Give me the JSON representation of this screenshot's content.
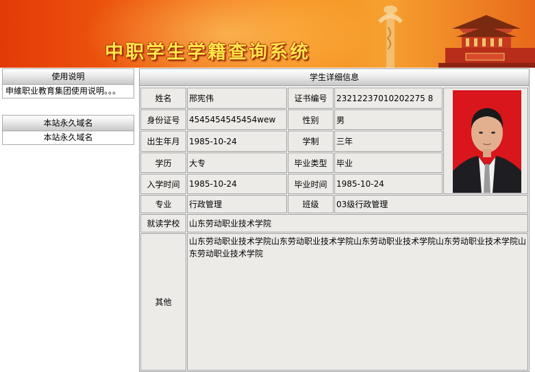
{
  "banner": {
    "title": "中职学生学籍查询系统"
  },
  "sidebar": {
    "usage": {
      "header": "使用说明",
      "item": "申維职业教育集团使用说明。。。"
    },
    "domain": {
      "header": "本站永久域名",
      "item": "本站永久域名"
    }
  },
  "student": {
    "header": "学生详细信息",
    "labels": {
      "name": "姓名",
      "cert_no": "证书编号",
      "id_no": "身份证号",
      "gender": "性别",
      "birth": "出生年月",
      "duration": "学制",
      "education": "学历",
      "grad_type": "毕业类型",
      "enroll_time": "入学时间",
      "grad_time": "毕业时间",
      "major": "专业",
      "class": "班级",
      "school": "就读学校",
      "other": "其他"
    },
    "values": {
      "name": "邢宪伟",
      "cert_no": "23212237010202275 8",
      "id_no": "4545454545454wew",
      "gender": "男",
      "birth": "1985-10-24",
      "duration": "三年",
      "education": "大专",
      "grad_type": "毕业",
      "enroll_time": "1985-10-24",
      "grad_time": "1985-10-24",
      "major": "行政管理",
      "class": "03级行政管理",
      "school": "山东劳动职业技术学院",
      "other": "山东劳动职业技术学院山东劳动职业技术学院山东劳动职业技术学院山东劳动职业技术学院山东劳动职业技术学院"
    }
  }
}
